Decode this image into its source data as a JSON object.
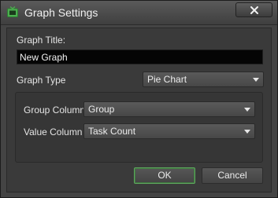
{
  "window": {
    "title": "Graph Settings",
    "close_icon": "close-x-icon",
    "app_icon": "tv-icon",
    "accent_color": "#4caf50"
  },
  "form": {
    "graph_title_label": "Graph Title:",
    "graph_title_value": "New Graph",
    "graph_type_label": "Graph Type",
    "graph_type_value": "Pie Chart",
    "group_column_label": "Group Column",
    "group_column_value": "Group",
    "value_column_label": "Value Column",
    "value_column_value": "Task Count"
  },
  "buttons": {
    "ok_label": "OK",
    "cancel_label": "Cancel"
  }
}
